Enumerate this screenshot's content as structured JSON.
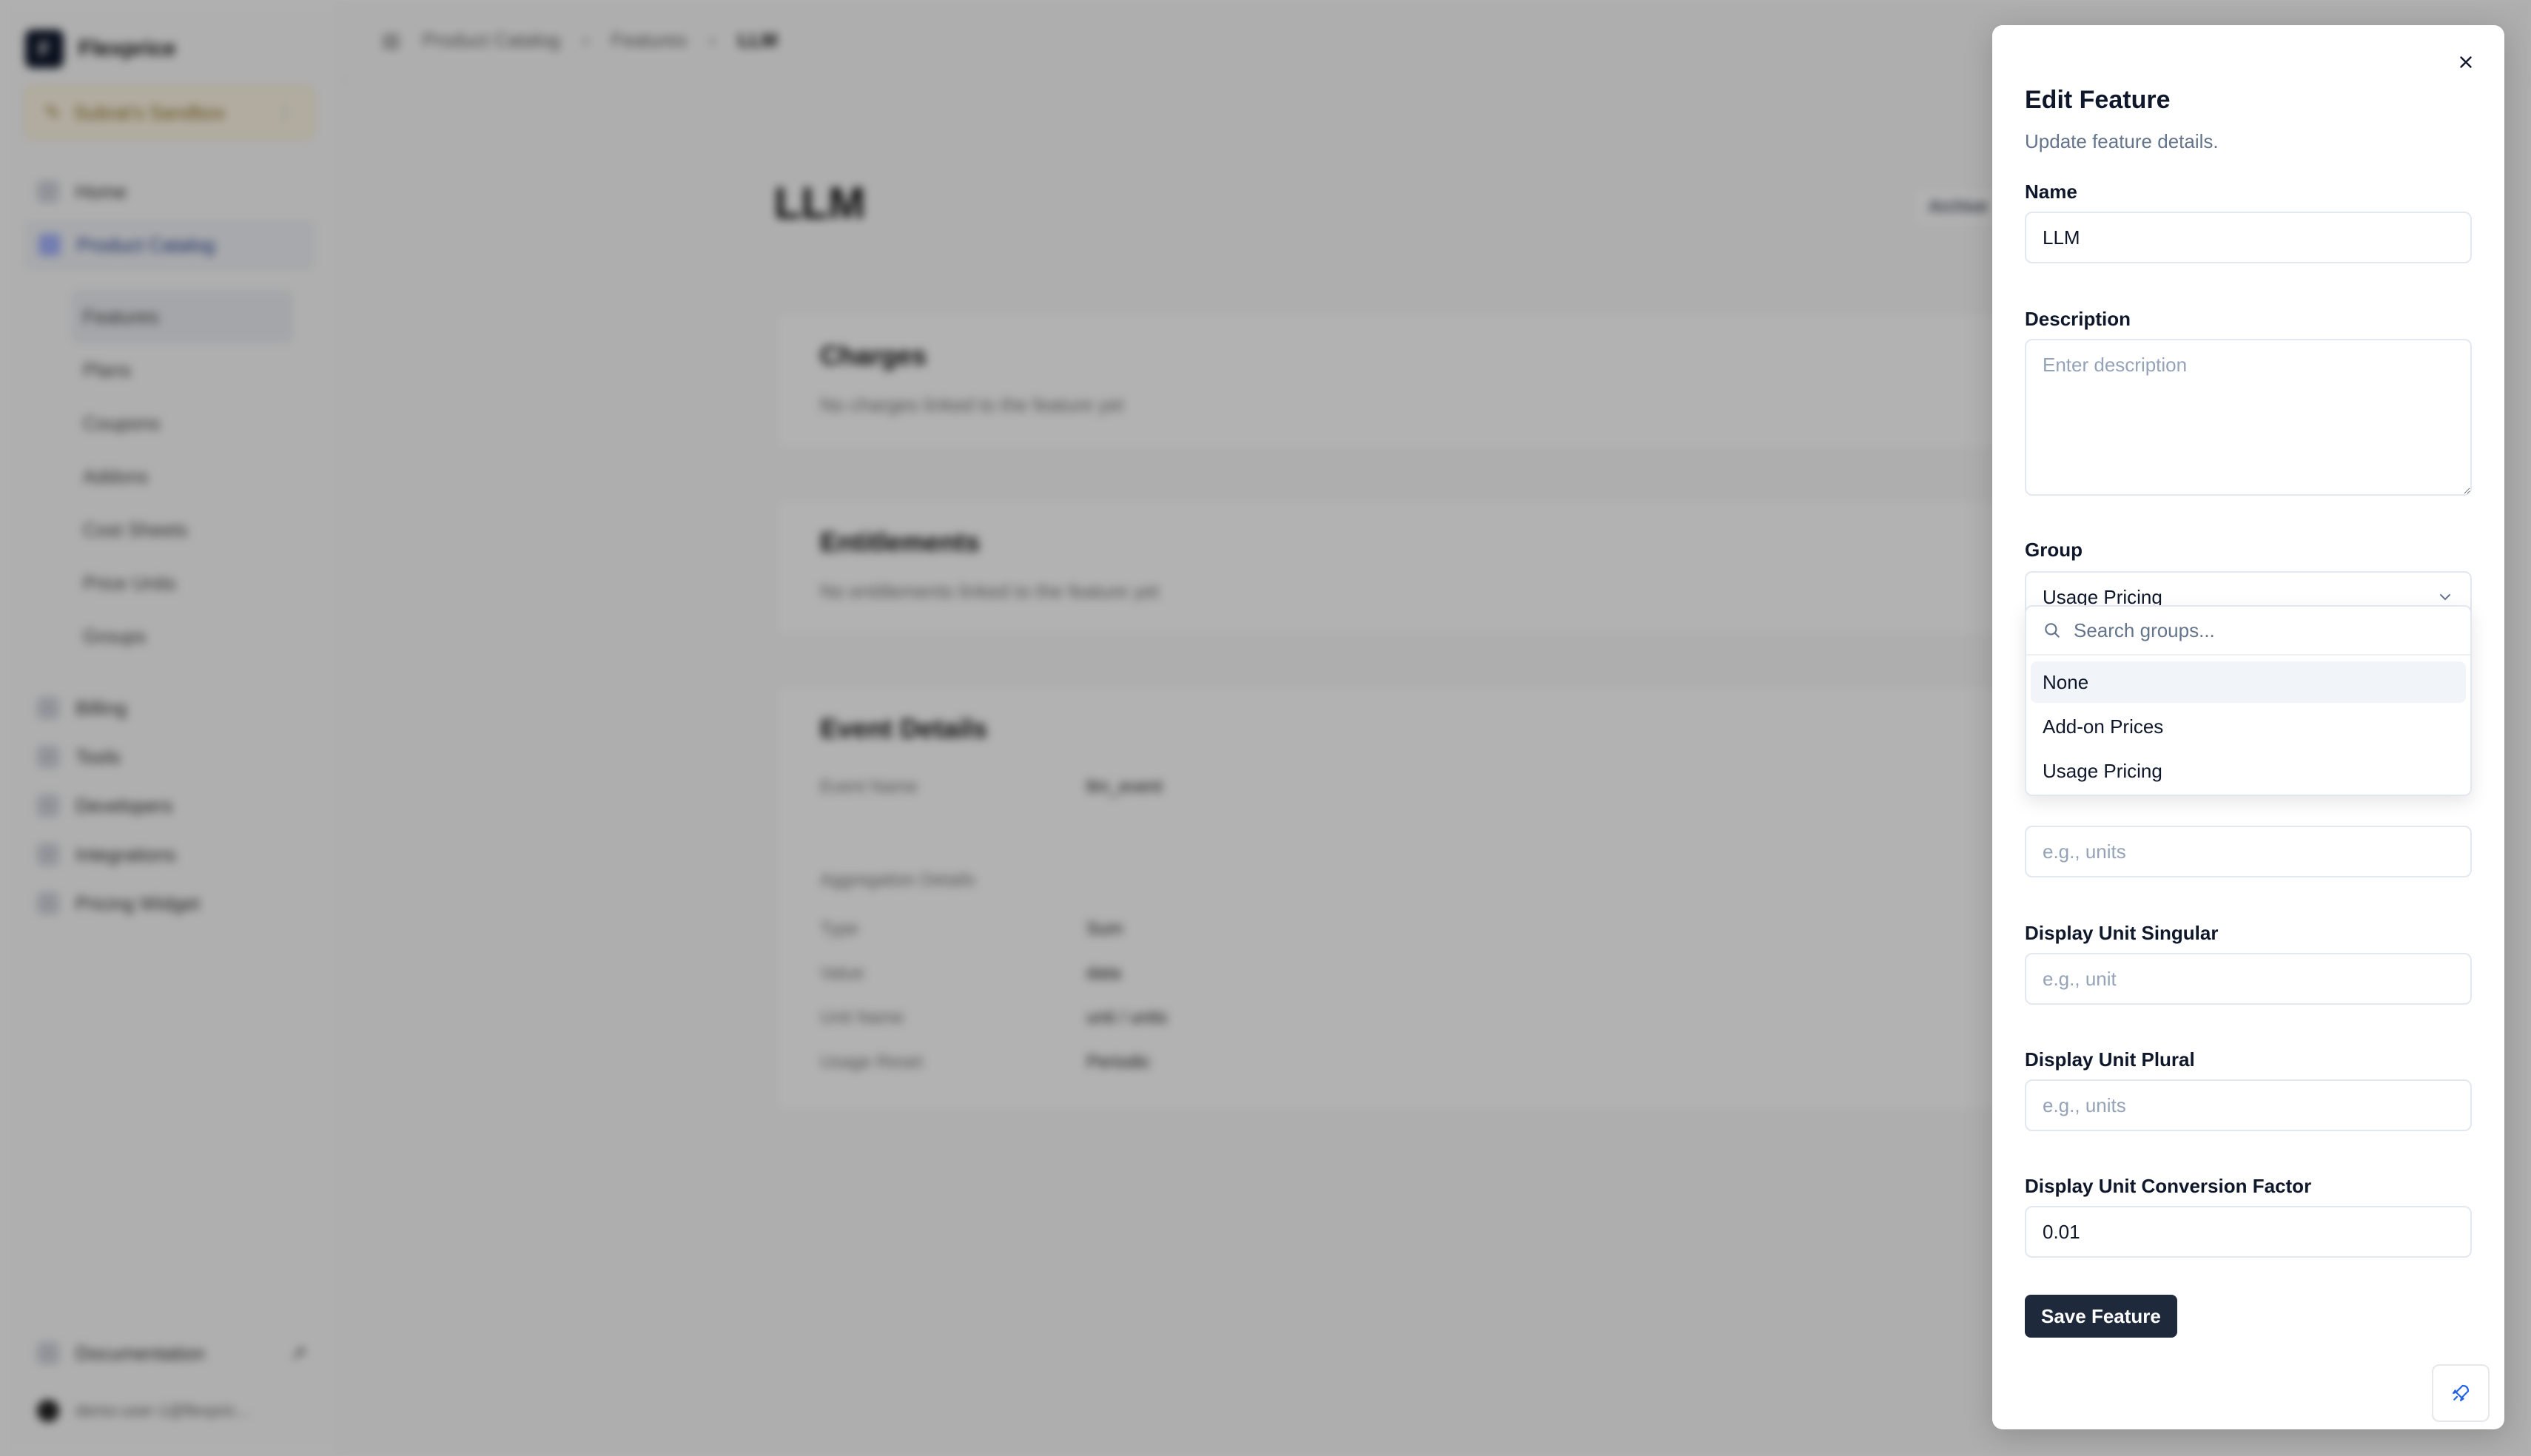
{
  "app": {
    "brand": "Flexprice",
    "brand_initial": "F",
    "environment": "Subrat's Sandbox"
  },
  "sidebar": {
    "items_top": [
      {
        "label": "Home",
        "icon": "home-icon"
      },
      {
        "label": "Product Catalog",
        "icon": "box-icon",
        "active": true
      }
    ],
    "sub_items": [
      {
        "label": "Features",
        "active": true
      },
      {
        "label": "Plans"
      },
      {
        "label": "Coupons"
      },
      {
        "label": "Addons"
      },
      {
        "label": "Cost Sheets"
      },
      {
        "label": "Price Units"
      },
      {
        "label": "Groups"
      }
    ],
    "items_bottom": [
      {
        "label": "Billing",
        "icon": "receipt-icon"
      },
      {
        "label": "Tools",
        "icon": "gear-icon"
      },
      {
        "label": "Developers",
        "icon": "code-icon"
      },
      {
        "label": "Integrations",
        "icon": "layers-icon"
      },
      {
        "label": "Pricing Widget",
        "icon": "widget-icon"
      }
    ],
    "documentation": "Documentation",
    "user_email": "demo-user-1@flexpric..."
  },
  "breadcrumb": [
    "Product Catalog",
    "Features",
    "LLM"
  ],
  "page": {
    "title": "LLM",
    "archive_label": "Archive",
    "charges": {
      "title": "Charges",
      "empty": "No charges linked to the feature yet"
    },
    "entitlements": {
      "title": "Entitlements",
      "empty": "No entitlements linked to the feature yet"
    },
    "event_details": {
      "title": "Event Details",
      "event_name_label": "Event Name",
      "event_name": "llm_event",
      "aggregation_title": "Aggregation Details",
      "rows": [
        {
          "label": "Type",
          "value": "Sum"
        },
        {
          "label": "Value",
          "value": "data"
        },
        {
          "label": "Unit Name",
          "value": "unit / units"
        },
        {
          "label": "Usage Reset",
          "value": "Periodic"
        }
      ]
    }
  },
  "edit_panel": {
    "title": "Edit Feature",
    "subtitle": "Update feature details.",
    "name_label": "Name",
    "name_value": "LLM",
    "description_label": "Description",
    "description_placeholder": "Enter description",
    "group_label": "Group",
    "group_value": "Usage Pricing",
    "group_search_placeholder": "Search groups...",
    "group_options": [
      "None",
      "Add-on Prices",
      "Usage Pricing"
    ],
    "unit_plural_placeholder_hidden": "e.g., units",
    "display_singular_label": "Display Unit Singular",
    "display_singular_placeholder": "e.g., unit",
    "display_plural_label": "Display Unit Plural",
    "display_plural_placeholder": "e.g., units",
    "conversion_label": "Display Unit Conversion Factor",
    "conversion_value": "0.01",
    "save_label": "Save Feature"
  }
}
